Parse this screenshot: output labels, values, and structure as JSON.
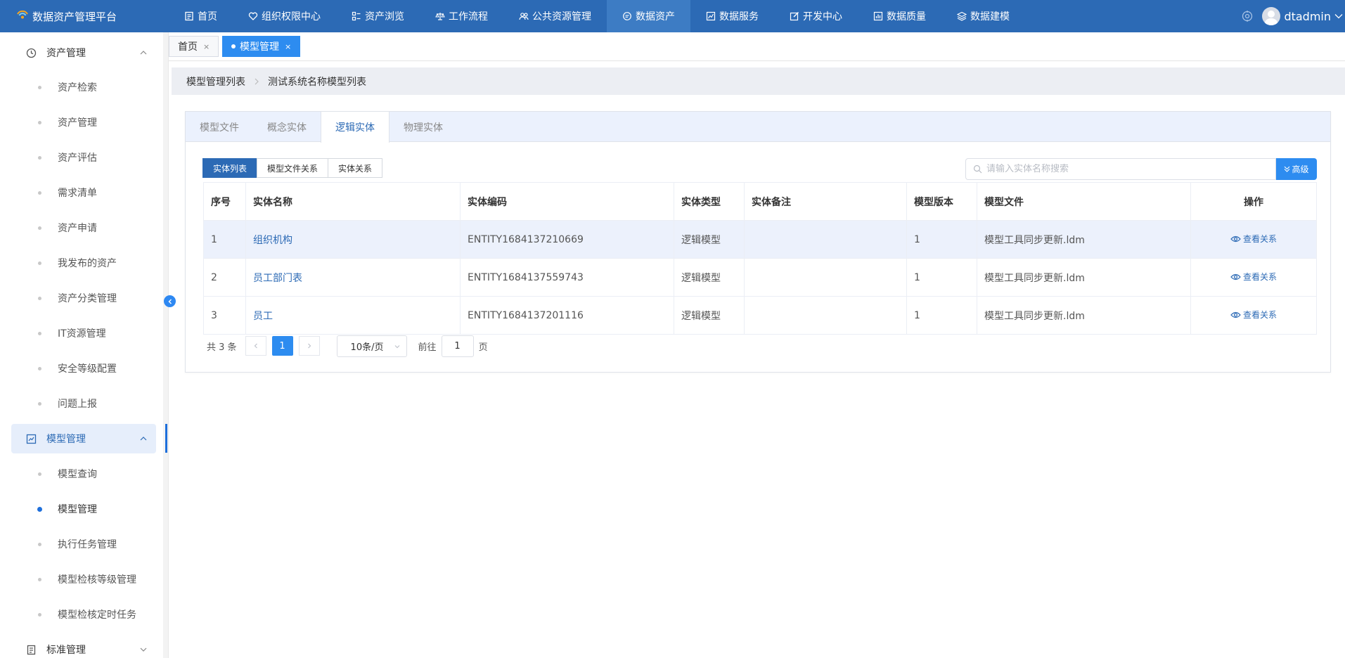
{
  "app": {
    "title": "数据资产管理平台"
  },
  "topnav": [
    {
      "label": "首页",
      "icon": "document-icon",
      "active": false
    },
    {
      "label": "组织权限中心",
      "icon": "heart-shield-icon",
      "active": false
    },
    {
      "label": "资产浏览",
      "icon": "grid-list-icon",
      "active": false
    },
    {
      "label": "工作流程",
      "icon": "scale-icon",
      "active": false
    },
    {
      "label": "公共资源管理",
      "icon": "people-icon",
      "active": false
    },
    {
      "label": "数据资产",
      "icon": "database-chat-icon",
      "active": true
    },
    {
      "label": "数据服务",
      "icon": "chart-box-icon",
      "active": false
    },
    {
      "label": "开发中心",
      "icon": "edit-icon",
      "active": false
    },
    {
      "label": "数据质量",
      "icon": "bar-chart-icon",
      "active": false
    },
    {
      "label": "数据建模",
      "icon": "layers-icon",
      "active": false
    }
  ],
  "user": {
    "name": "dtadmin"
  },
  "sidebar": {
    "groups": [
      {
        "label": "资产管理",
        "icon": "clock-icon",
        "expanded": true,
        "active": false
      },
      {
        "label": "模型管理",
        "icon": "chart-square-icon",
        "expanded": true,
        "active": true
      },
      {
        "label": "标准管理",
        "icon": "document-icon",
        "expanded": false,
        "active": false
      }
    ],
    "asset_items": [
      "资产检索",
      "资产管理",
      "资产评估",
      "需求清单",
      "资产申请",
      "我发布的资产",
      "资产分类管理",
      "IT资源管理",
      "安全等级配置",
      "问题上报"
    ],
    "model_items": [
      "模型查询",
      "模型管理",
      "执行任务管理",
      "模型检核等级管理",
      "模型检核定时任务"
    ],
    "active_model_item": "模型管理"
  },
  "page_tabs": [
    {
      "label": "首页",
      "close": "×",
      "active": false
    },
    {
      "label": "模型管理",
      "close": "×",
      "active": true
    }
  ],
  "breadcrumb": [
    "模型管理列表",
    "测试系统名称模型列表"
  ],
  "card_tabs": [
    {
      "label": "模型文件",
      "active": false
    },
    {
      "label": "概念实体",
      "active": false
    },
    {
      "label": "逻辑实体",
      "active": true
    },
    {
      "label": "物理实体",
      "active": false
    }
  ],
  "segments": [
    {
      "label": "实体列表",
      "active": true
    },
    {
      "label": "模型文件关系",
      "active": false
    },
    {
      "label": "实体关系",
      "active": false
    }
  ],
  "search": {
    "placeholder": "请输入实体名称搜索",
    "value": "",
    "advanced_label": "高级"
  },
  "table": {
    "columns": [
      "序号",
      "实体名称",
      "实体编码",
      "实体类型",
      "实体备注",
      "模型版本",
      "模型文件",
      "操作"
    ],
    "rows": [
      {
        "index": "1",
        "name": "组织机构",
        "code": "ENTITY1684137210669",
        "type": "逻辑模型",
        "remark": "",
        "version": "1",
        "file": "模型工具同步更新.ldm",
        "action": "查看关系"
      },
      {
        "index": "2",
        "name": "员工部门表",
        "code": "ENTITY1684137559743",
        "type": "逻辑模型",
        "remark": "",
        "version": "1",
        "file": "模型工具同步更新.ldm",
        "action": "查看关系"
      },
      {
        "index": "3",
        "name": "员工",
        "code": "ENTITY1684137201116",
        "type": "逻辑模型",
        "remark": "",
        "version": "1",
        "file": "模型工具同步更新.ldm",
        "action": "查看关系"
      }
    ]
  },
  "pagination": {
    "total": "共 3 条",
    "current_page": "1",
    "page_size": "10条/页",
    "goto_label": "前往",
    "goto_value": "1",
    "page_suffix": "页"
  },
  "colors": {
    "topbar": "#2c6ab5",
    "accent": "#2d8cf0",
    "link": "#2c6ab5"
  }
}
